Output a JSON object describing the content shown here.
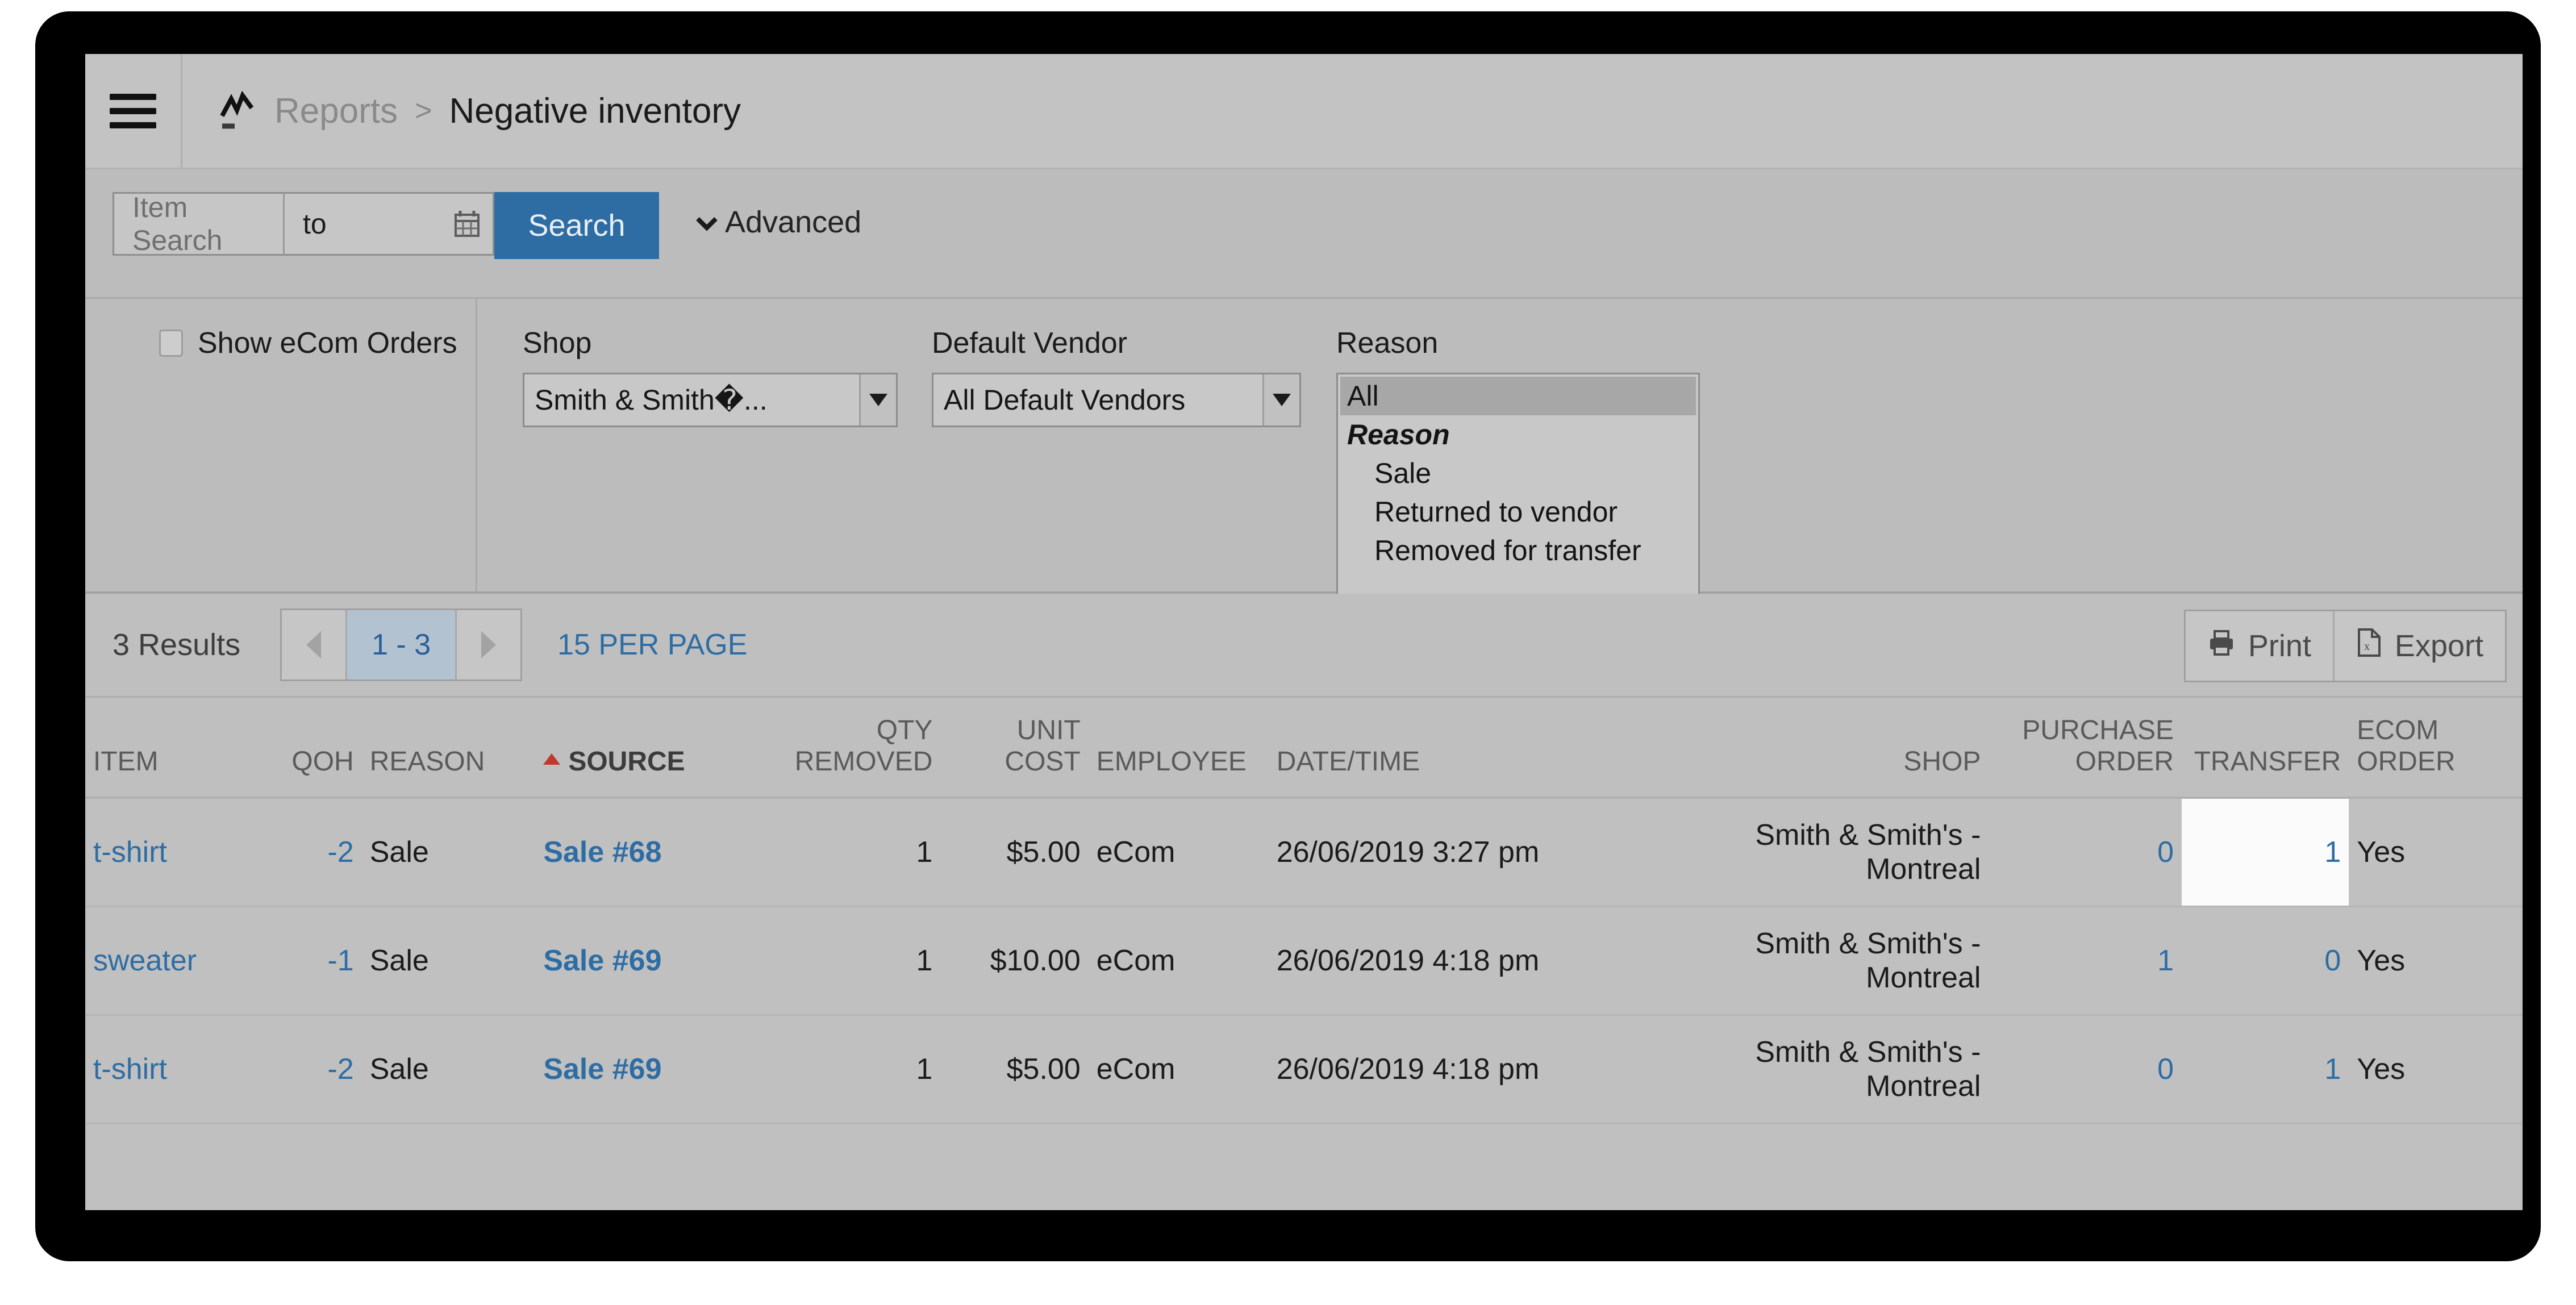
{
  "window": {
    "header": {
      "menu_icon": "hamburger-icon",
      "section_icon": "chart-line-icon",
      "breadcrumb_parent": "Reports",
      "breadcrumb_separator": ">",
      "breadcrumb_current": "Negative inventory"
    },
    "search": {
      "item_search_placeholder": "Item Search",
      "date_range_value": "to",
      "calendar_icon": "calendar-icon",
      "search_button": "Search",
      "advanced_label": "Advanced",
      "advanced_icon": "chevron-down-icon",
      "button_color": "#2e6da4"
    },
    "filters": {
      "show_ecom_orders_label": "Show eCom Orders",
      "show_ecom_orders_checked": false,
      "shop": {
        "label": "Shop",
        "value": "Smith & Smith�..."
      },
      "default_vendor": {
        "label": "Default Vendor",
        "value": "All Default Vendors"
      },
      "reason": {
        "label": "Reason",
        "options": [
          {
            "text": "All",
            "type": "option",
            "selected": true
          },
          {
            "text": "Reason",
            "type": "group",
            "selected": false
          },
          {
            "text": "Sale",
            "type": "indented",
            "selected": false
          },
          {
            "text": "Returned to vendor",
            "type": "indented",
            "selected": false
          },
          {
            "text": "Removed for transfer",
            "type": "indented",
            "selected": false
          }
        ]
      }
    },
    "results_bar": {
      "results_count": "3 Results",
      "prev_icon": "triangle-left-icon",
      "next_icon": "triangle-right-icon",
      "page_range": "1 - 3",
      "per_page": "15 PER PAGE",
      "print_label": "Print",
      "print_icon": "printer-icon",
      "export_label": "Export",
      "export_icon": "spreadsheet-file-icon"
    },
    "table": {
      "sort_column": "SOURCE",
      "sort_direction": "asc",
      "sort_icon": "caret-up-icon",
      "columns": [
        {
          "label": "ITEM",
          "align": "left"
        },
        {
          "label": "QOH",
          "align": "right"
        },
        {
          "label": "REASON",
          "align": "left"
        },
        {
          "label": "SOURCE",
          "align": "left"
        },
        {
          "label": "QTY REMOVED",
          "align": "right"
        },
        {
          "label": "UNIT COST",
          "align": "right"
        },
        {
          "label": "EMPLOYEE",
          "align": "left"
        },
        {
          "label": "DATE/TIME",
          "align": "left"
        },
        {
          "label": "SHOP",
          "align": "right"
        },
        {
          "label": "PURCHASE ORDER",
          "align": "right"
        },
        {
          "label": "TRANSFER",
          "align": "right"
        },
        {
          "label": "ECOM ORDER",
          "align": "left"
        }
      ],
      "rows": [
        {
          "item": "t-shirt",
          "qoh": "-2",
          "reason": "Sale",
          "source": "Sale #68",
          "qty_removed": "1",
          "unit_cost": "$5.00",
          "employee": "eCom",
          "datetime": "26/06/2019 3:27 pm",
          "shop": "Smith & Smith's - Montreal",
          "purchase_order": "0",
          "transfer": "1",
          "transfer_highlighted": true,
          "ecom_order": "Yes"
        },
        {
          "item": "sweater",
          "qoh": "-1",
          "reason": "Sale",
          "source": "Sale #69",
          "qty_removed": "1",
          "unit_cost": "$10.00",
          "employee": "eCom",
          "datetime": "26/06/2019 4:18 pm",
          "shop": "Smith & Smith's - Montreal",
          "purchase_order": "1",
          "transfer": "0",
          "transfer_highlighted": false,
          "ecom_order": "Yes"
        },
        {
          "item": "t-shirt",
          "qoh": "-2",
          "reason": "Sale",
          "source": "Sale #69",
          "qty_removed": "1",
          "unit_cost": "$5.00",
          "employee": "eCom",
          "datetime": "26/06/2019 4:18 pm",
          "shop": "Smith & Smith's - Montreal",
          "purchase_order": "0",
          "transfer": "1",
          "transfer_highlighted": false,
          "ecom_order": "Yes"
        }
      ]
    },
    "colors": {
      "link": "#2e6da4",
      "accent": "#2e6da4",
      "sort_marker": "#c0392b",
      "page_bg": "#c0c0c0"
    }
  }
}
